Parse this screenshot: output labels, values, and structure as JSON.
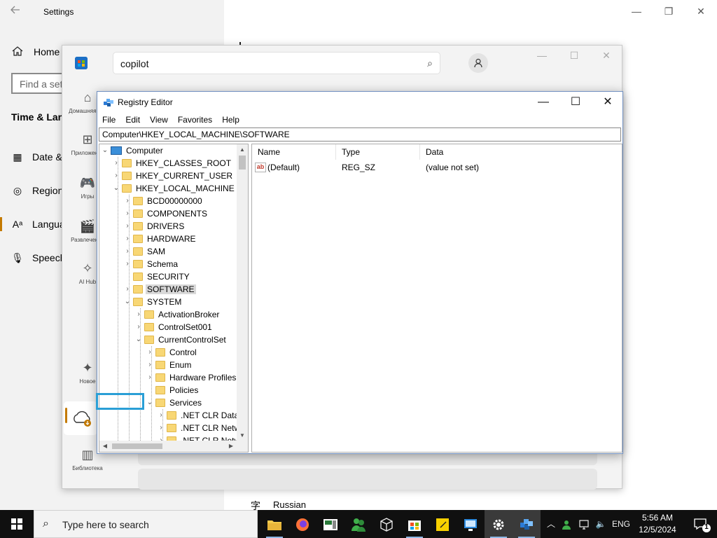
{
  "settings": {
    "title": "Settings",
    "home": "Home",
    "find_placeholder": "Find a set",
    "section": "Time & Lan",
    "items": [
      {
        "label": "Date &",
        "icon": "calendar-clock-icon"
      },
      {
        "label": "Region",
        "icon": "globe-icon"
      },
      {
        "label": "Langua",
        "icon": "language-icon"
      },
      {
        "label": "Speech",
        "icon": "microphone-icon"
      }
    ],
    "bottom_lang": "Russian"
  },
  "store": {
    "search_value": "copilot",
    "nav": [
      {
        "label": "Домашняя стр",
        "icon": "home-icon"
      },
      {
        "label": "Приложения",
        "icon": "apps-icon"
      },
      {
        "label": "Игры",
        "icon": "gamepad-icon"
      },
      {
        "label": "Развлечения",
        "icon": "film-icon"
      },
      {
        "label": "AI Hub",
        "icon": "sparkle-icon"
      },
      {
        "label": "Новое",
        "icon": "new-icon"
      },
      {
        "label": "Библиотека",
        "icon": "library-icon"
      }
    ],
    "accent": "#c47a00"
  },
  "registry": {
    "title": "Registry Editor",
    "menu": [
      "File",
      "Edit",
      "View",
      "Favorites",
      "Help"
    ],
    "address": "Computer\\HKEY_LOCAL_MACHINE\\SOFTWARE",
    "tree": {
      "root": "Computer",
      "hives": [
        "HKEY_CLASSES_ROOT",
        "HKEY_CURRENT_USER",
        "HKEY_LOCAL_MACHINE"
      ],
      "hklm_children": [
        "BCD00000000",
        "COMPONENTS",
        "DRIVERS",
        "HARDWARE",
        "SAM",
        "Schema",
        "SECURITY",
        "SOFTWARE",
        "SYSTEM"
      ],
      "system_children": [
        "ActivationBroker",
        "ControlSet001",
        "CurrentControlSet"
      ],
      "ccs_children": [
        "Control",
        "Enum",
        "Hardware Profiles",
        "Policies",
        "Services"
      ],
      "services_children": [
        ".NET CLR Data",
        ".NET CLR Netw",
        ".NET CLR Netw"
      ]
    },
    "columns": [
      "Name",
      "Type",
      "Data"
    ],
    "rows": [
      {
        "name": "(Default)",
        "type": "REG_SZ",
        "data": "(value not set)",
        "icon": "ab"
      }
    ]
  },
  "taskbar": {
    "search_placeholder": "Type here to search",
    "time": "5:56 AM",
    "date": "12/5/2024",
    "lang": "ENG",
    "notification_count": "1",
    "apps": [
      "file-explorer-icon",
      "firefox-icon",
      "media-player-icon",
      "people-icon",
      "package-icon",
      "store-icon",
      "sticky-notes-icon",
      "remote-desktop-icon",
      "settings-icon",
      "registry-editor-icon"
    ]
  }
}
